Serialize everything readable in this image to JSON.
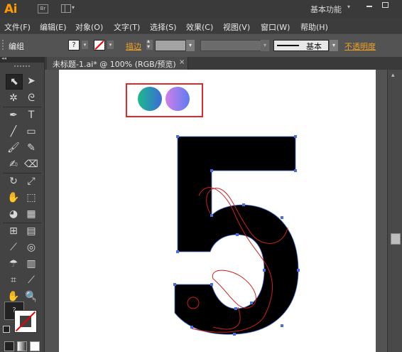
{
  "app": {
    "logo": "Ai",
    "bridge_label": "Br",
    "workspace_label": "基本功能",
    "workspace_arrow": "▾"
  },
  "menu": {
    "items": [
      "文件(F)",
      "编辑(E)",
      "对象(O)",
      "文字(T)",
      "选择(S)",
      "效果(C)",
      "视图(V)",
      "窗口(W)",
      "帮助(H)"
    ]
  },
  "control": {
    "selection_label": "编组",
    "fill_placeholder": "?",
    "stroke_label": "描边",
    "style_label": "基本",
    "opacity_label": "不透明度"
  },
  "document": {
    "tab_title": "未标题-1.ai* @ 100% (RGB/预览)",
    "close_glyph": "×"
  },
  "tools": {
    "fill_placeholder": "?"
  },
  "canvas": {
    "gradient_swatches": [
      {
        "from": "#1bbb8a",
        "to": "#3b6bd8"
      },
      {
        "from": "#d07fe8",
        "to": "#5c7cf0"
      }
    ],
    "glyph_color": "#000000",
    "path_color": "#cc2020",
    "anchor_color": "#4a6fd8",
    "highlight_color": "#e02a2a"
  }
}
